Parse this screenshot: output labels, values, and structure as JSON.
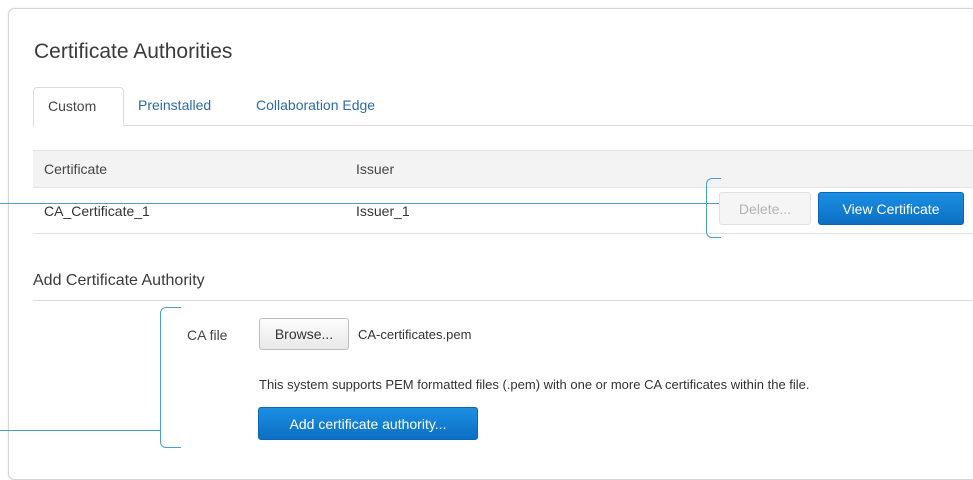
{
  "page": {
    "title": "Certificate Authorities"
  },
  "tabs": [
    {
      "label": "Custom",
      "active": true
    },
    {
      "label": "Preinstalled",
      "active": false
    },
    {
      "label": "Collaboration Edge",
      "active": false
    }
  ],
  "table": {
    "headers": {
      "certificate": "Certificate",
      "issuer": "Issuer"
    },
    "rows": [
      {
        "certificate": "CA_Certificate_1",
        "issuer": "Issuer_1"
      }
    ],
    "actions": {
      "delete_label": "Delete...",
      "view_label": "View Certificate"
    }
  },
  "add_section": {
    "title": "Add Certificate Authority",
    "ca_file_label": "CA file",
    "browse_label": "Browse...",
    "file_name": "CA-certificates.pem",
    "help_text": "This system supports PEM formatted files (.pem) with one or more CA certificates within the file.",
    "add_button_label": "Add certificate authority..."
  },
  "colors": {
    "primary_button": "#0c6fc4",
    "link": "#2a6ba8",
    "callout_line": "#4a9fc9"
  }
}
